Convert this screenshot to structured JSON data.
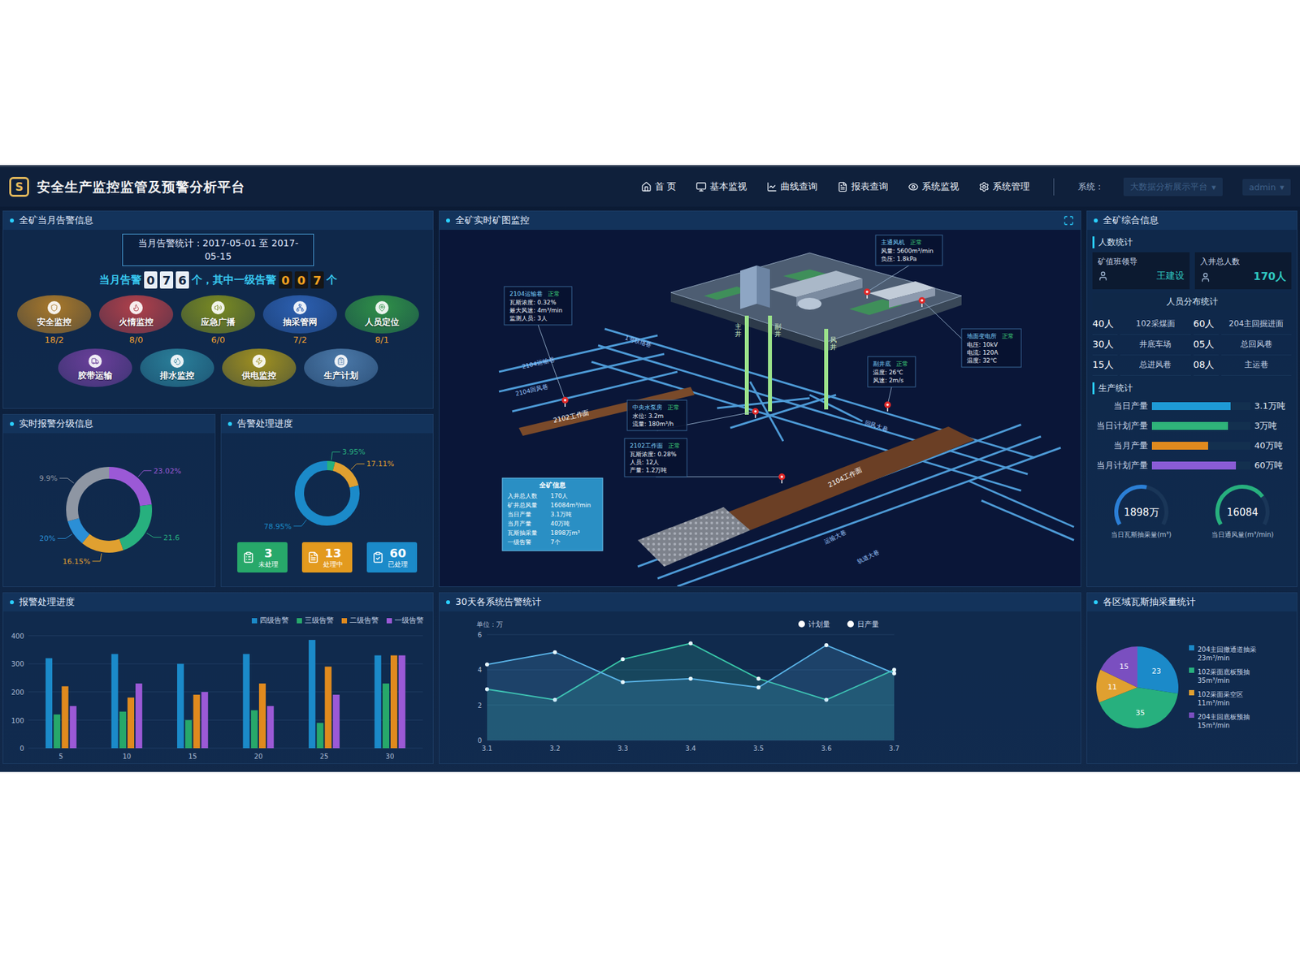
{
  "header": {
    "logo": "S",
    "title": "安全生产监控监管及预警分析平台",
    "nav": [
      {
        "label": "首 页",
        "selected": false
      },
      {
        "label": "基本监视",
        "selected": false
      },
      {
        "label": "曲线查询",
        "selected": false
      },
      {
        "label": "报表查询",
        "selected": false
      },
      {
        "label": "系统监视",
        "selected": false
      },
      {
        "label": "系统管理",
        "selected": false
      }
    ],
    "system_label": "系统：",
    "system_value": "大数据分析展示平台",
    "user": "admin",
    "caret": "▾"
  },
  "alarm": {
    "title": "全矿当月告警信息",
    "period": "当月告警统计：2017-05-01 至 2017-05-15",
    "count_label": "当月告警",
    "count_digits": [
      "0",
      "7",
      "6"
    ],
    "count_unit": "个，其中一级告警",
    "level1_digits": [
      "0",
      "0",
      "7"
    ],
    "level1_unit": "个",
    "systems": [
      {
        "name": "安全监控",
        "count": "18/2",
        "color": "#a8782a"
      },
      {
        "name": "火情监控",
        "count": "8/0",
        "color": "#b0404a"
      },
      {
        "name": "应急广播",
        "count": "6/0",
        "color": "#7a8a22"
      },
      {
        "name": "抽采管网",
        "count": "7/2",
        "color": "#2c5fb0"
      },
      {
        "name": "人员定位",
        "count": "8/1",
        "color": "#2f8f48"
      },
      {
        "name": "胶带运输",
        "color": "#6a3f9a"
      },
      {
        "name": "排水监控",
        "color": "#2a7f9a"
      },
      {
        "name": "供电监控",
        "color": "#a09020"
      },
      {
        "name": "生产计划",
        "color": "#4a78a8"
      }
    ]
  },
  "grade": {
    "title": "实时报警分级信息",
    "segments": [
      {
        "label": "23.02%",
        "value": 23.02,
        "color": "#9b59d6"
      },
      {
        "label": "21.6",
        "value": 21.6,
        "color": "#27b07e"
      },
      {
        "label": "16.15%",
        "value": 16.15,
        "color": "#e0a030"
      },
      {
        "label": "20%",
        "value": 9.9,
        "color": "#2b8fd6"
      },
      {
        "label": "9.9%",
        "value": 29.33,
        "color": "#8e96a3"
      }
    ]
  },
  "progress": {
    "title": "告警处理进度",
    "segments": [
      {
        "label": "3.95%",
        "value": 3.95,
        "color": "#27b07e"
      },
      {
        "label": "17.11%",
        "value": 17.11,
        "color": "#e0a030"
      },
      {
        "label": "78.95%",
        "value": 78.95,
        "color": "#1b8ac9"
      }
    ],
    "boxes": [
      {
        "count": "3",
        "label": "未处理",
        "color": "#27a86a"
      },
      {
        "count": "13",
        "label": "处理中",
        "color": "#e39a1e"
      },
      {
        "count": "60",
        "label": "已处理",
        "color": "#1b8ac9"
      }
    ]
  },
  "map": {
    "title": "全矿实时矿图监控",
    "info_boxes": [
      {
        "title": "2104运输巷",
        "status": "正常",
        "lines": [
          "瓦斯浓度: 0.32%",
          "最大风速: 4m³/min",
          "监测人员: 3人"
        ]
      },
      {
        "title": "主通风机",
        "status": "正常",
        "lines": [
          "风量: 5600m³/min",
          "负压: 1.8kPa"
        ]
      },
      {
        "title": "地面变电所",
        "status": "正常",
        "lines": [
          "电压: 10kV",
          "电流: 120A",
          "温度: 32℃"
        ]
      },
      {
        "title": "副井底",
        "status": "正常",
        "lines": [
          "温度: 26℃",
          "风速: 2m/s"
        ]
      },
      {
        "title": "中央水泵房",
        "status": "正常",
        "lines": [
          "水位: 3.2m",
          "流量: 180m³/h"
        ]
      },
      {
        "title": "2102工作面",
        "status": "正常",
        "lines": [
          "瓦斯浓度: 0.28%",
          "人员: 12人",
          "产量: 1.2万吨"
        ]
      }
    ],
    "shafts": [
      "主井",
      "副井",
      "风井"
    ],
    "tunnel_labels": [
      "2104运输巷",
      "2104回风巷",
      "1号联络巷",
      "回风大巷",
      "运输大巷",
      "轨道大巷"
    ],
    "workfaces": [
      "2102工作面",
      "2104工作面"
    ],
    "legend": {
      "title": "全矿信息",
      "rows": [
        {
          "label": "入井总人数",
          "value": "170人"
        },
        {
          "label": "矿井总风量",
          "value": "16084m³/min"
        },
        {
          "label": "当日产量",
          "value": "3.1万吨"
        },
        {
          "label": "当月产量",
          "value": "40万吨"
        },
        {
          "label": "瓦斯抽采量",
          "value": "1898万m³"
        },
        {
          "label": "一级告警",
          "value": "7个"
        }
      ]
    }
  },
  "summary": {
    "title": "全矿综合信息",
    "people_heading": "人数统计",
    "leader_label": "矿值班领导",
    "leader_name": "王建设",
    "total_label": "入井总人数",
    "total_value": "170人",
    "distribution_title": "人员分布统计",
    "distribution": [
      {
        "count": "40人",
        "place": "102采煤面"
      },
      {
        "count": "60人",
        "place": "204主回掘进面"
      },
      {
        "count": "30人",
        "place": "井底车场"
      },
      {
        "count": "05人",
        "place": "总回风巷"
      },
      {
        "count": "15人",
        "place": "总进风巷"
      },
      {
        "count": "08人",
        "place": "主运巷"
      }
    ],
    "production_heading": "生产统计",
    "production": [
      {
        "label": "当日产量",
        "value": "3.1万吨",
        "level": 0.8,
        "color": "#1e9ad6"
      },
      {
        "label": "当日计划产量",
        "value": "3万吨",
        "level": 0.77,
        "color": "#2fb37a"
      },
      {
        "label": "当月产量",
        "value": "40万吨",
        "level": 0.57,
        "color": "#e08a1e"
      },
      {
        "label": "当月计划产量",
        "value": "60万吨",
        "level": 0.85,
        "color": "#8a5cd6"
      }
    ],
    "gauges": [
      {
        "value": "1898万",
        "label": "当日瓦斯抽采量(m³)",
        "level": 0.55,
        "color": "#2b7fd6"
      },
      {
        "value": "16084",
        "label": "当日通风量(m³/min)",
        "level": 0.72,
        "color": "#27b07e"
      }
    ]
  },
  "alarm_bars": {
    "title": "报警处理进度",
    "y_ticks": [
      "0",
      "100",
      "200",
      "300",
      "400"
    ],
    "x_labels": [
      "5",
      "10",
      "15",
      "20",
      "25",
      "30"
    ],
    "series": [
      {
        "label": "四级告警",
        "color": "#1b8ac9",
        "values": [
          320,
          335,
          300,
          335,
          385,
          330
        ]
      },
      {
        "label": "三级告警",
        "color": "#27a86a",
        "values": [
          120,
          130,
          100,
          135,
          90,
          230
        ]
      },
      {
        "label": "二级告警",
        "color": "#e08a1e",
        "values": [
          220,
          180,
          190,
          230,
          290,
          330
        ]
      },
      {
        "label": "一级告警",
        "color": "#9b59d6",
        "values": [
          150,
          230,
          200,
          150,
          190,
          330
        ]
      }
    ]
  },
  "trend": {
    "title": "30天各系统告警统计",
    "unit": "单位：万",
    "y_ticks": [
      "0",
      "2",
      "4",
      "6"
    ],
    "x_labels": [
      "3.1",
      "3.2",
      "3.3",
      "3.4",
      "3.5",
      "3.6",
      "3.7"
    ],
    "series": [
      {
        "label": "计划量",
        "color": "#39c6a8",
        "values": [
          2.9,
          2.3,
          4.6,
          5.5,
          3.5,
          2.3,
          4.0
        ]
      },
      {
        "label": "日产量",
        "color": "#5ab4e8",
        "values": [
          4.3,
          5.0,
          3.3,
          3.5,
          3.0,
          5.4,
          3.8
        ]
      }
    ]
  },
  "gas": {
    "title": "各区域瓦斯抽采量统计",
    "slices": [
      {
        "value": "23",
        "amount": 23,
        "label": "204主回撤通道抽采",
        "rate": "23m³/min",
        "color": "#1b8ac9"
      },
      {
        "value": "35",
        "amount": 35,
        "label": "102采面底板预抽",
        "rate": "35m³/min",
        "color": "#27b07e"
      },
      {
        "value": "11",
        "amount": 11,
        "label": "102采面采空区",
        "rate": "11m³/min",
        "color": "#e0a030"
      },
      {
        "value": "15",
        "amount": 15,
        "label": "204主回底板预抽",
        "rate": "15m³/min",
        "color": "#7a4fc0"
      }
    ]
  }
}
